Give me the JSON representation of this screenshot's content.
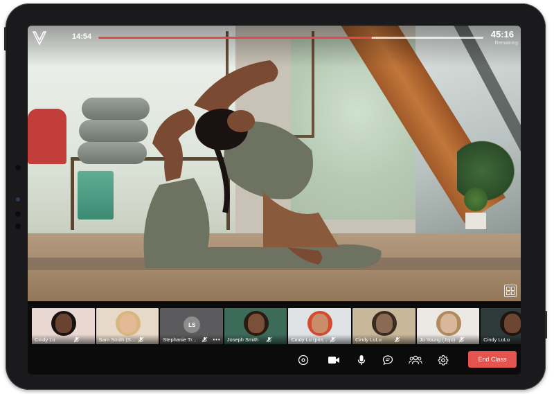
{
  "player": {
    "elapsed": "14:54",
    "remaining_time": "45:16",
    "remaining_label": "Remaining",
    "progress_fraction": 0.71,
    "accent": "#e24a4a"
  },
  "participants": [
    {
      "name": "Cindy Lu",
      "tint": "#e9d7d2",
      "skin": "#6a4330",
      "hair": "#1a1210",
      "video": true
    },
    {
      "name": "Sam Smith (S...",
      "tint": "#e7d9c9",
      "skin": "#e3b996",
      "hair": "#d7b77e",
      "video": true
    },
    {
      "name": "Stephanie Tr...",
      "initials": "LS",
      "tint": "#5b5b5d",
      "video": false
    },
    {
      "name": "Joseph Smith",
      "tint": "#3d6b5a",
      "skin": "#7a5038",
      "hair": "#2a1a12",
      "video": true
    },
    {
      "name": "Cindy Lu (pict...",
      "tint": "#dfe3e6",
      "skin": "#c98d6a",
      "hair": "#d44a2e",
      "video": true
    },
    {
      "name": "Cindy LuLu",
      "tint": "#c9b79a",
      "skin": "#8a6a52",
      "hair": "#3b2c22",
      "video": true
    },
    {
      "name": "Jo Young (Jojo)",
      "tint": "#ece8e4",
      "skin": "#d9b79a",
      "hair": "#b08a5e",
      "video": true
    },
    {
      "name": "Cindy LuLu",
      "tint": "#2f3a3a",
      "skin": "#6c4630",
      "hair": "#1e1410",
      "video": true
    }
  ],
  "controls": {
    "end_label": "End Class",
    "icons": [
      "record-icon",
      "camera-icon",
      "microphone-icon",
      "chat-icon",
      "participants-icon",
      "settings-icon"
    ],
    "end_color": "#e5534e"
  }
}
